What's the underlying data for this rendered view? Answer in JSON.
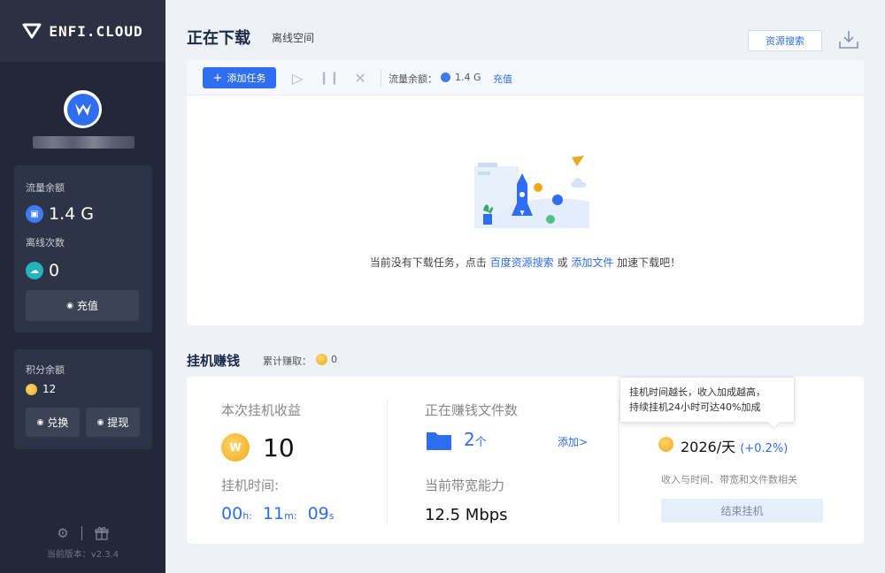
{
  "sidebar": {
    "logo_text": "ENFI.CLOUD",
    "balance_card": {
      "traffic_label": "流量余额",
      "traffic_value": "1.4 G",
      "offline_label": "离线次数",
      "offline_value": "0",
      "recharge_label": "充值"
    },
    "points_card": {
      "points_label": "积分余额",
      "points_value": "12",
      "exchange_label": "兑换",
      "withdraw_label": "提现"
    },
    "version_label": "当前版本：v2.3.4"
  },
  "header": {
    "title": "正在下载",
    "offline_tab": "离线空间",
    "search_button": "资源搜索"
  },
  "toolbar": {
    "add_task_label": "添加任务",
    "traffic_label": "流量余额：",
    "traffic_value": "1.4 G",
    "recharge_label": "充值"
  },
  "empty_state": {
    "prefix": "当前没有下载任务，点击",
    "link1": "百度资源搜索",
    "middle": "或",
    "link2": "添加文件",
    "suffix": "加速下载吧！"
  },
  "earn": {
    "section_title": "挂机赚钱",
    "total_label": "累计赚取：",
    "total_value": "0",
    "session_label": "本次挂机收益",
    "session_value": "10",
    "time_label": "挂机时间:",
    "time_h": "00",
    "time_h_unit": "h:",
    "time_m": "11",
    "time_m_unit": "m:",
    "time_s": "09",
    "time_s_unit": "s",
    "files_label": "正在赚钱文件数",
    "files_value": "2",
    "files_unit": "个",
    "add_link": "添加>",
    "bandwidth_label": "当前带宽能力",
    "bandwidth_value": "12.5 Mbps",
    "rate_value": "2026/天",
    "rate_bonus": "(+0.2%)",
    "rate_note": "收入与时间、带宽和文件数相关",
    "stop_button": "结束挂机",
    "tooltip_line1": "挂机时间越长，收入加成越高，",
    "tooltip_line2": "持续挂机24小时可达40%加成"
  },
  "colors": {
    "accent": "#2f6ef0",
    "sidebar_bg": "#232838",
    "coin": "#f0a81c"
  }
}
